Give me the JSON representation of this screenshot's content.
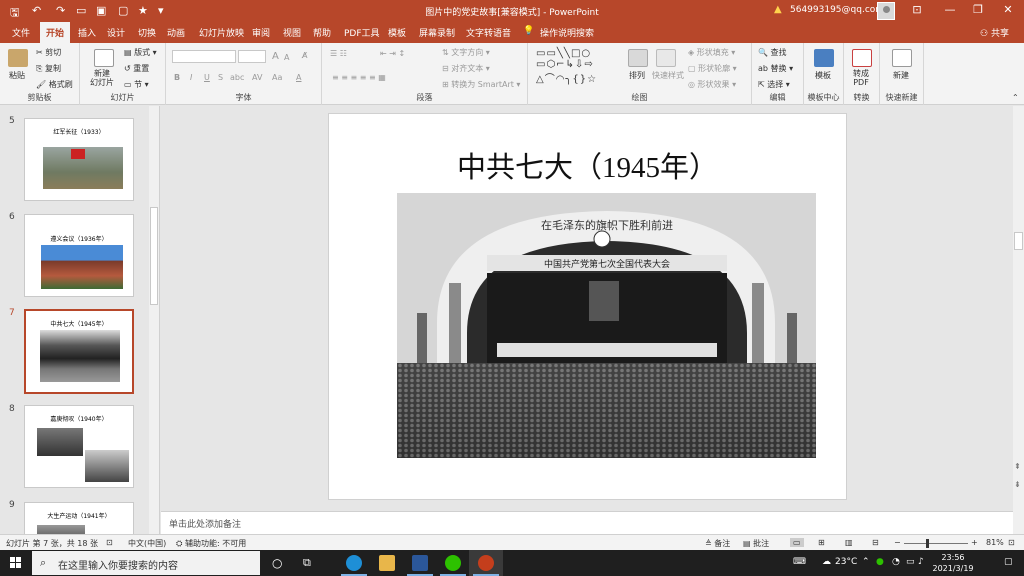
{
  "window": {
    "title": "图片中的党史故事[兼容模式] - PowerPoint",
    "account": "564993195@qq.com",
    "share": "共享"
  },
  "tabs": [
    "文件",
    "开始",
    "插入",
    "设计",
    "切换",
    "动画",
    "幻灯片放映",
    "审阅",
    "视图",
    "帮助",
    "PDF工具",
    "模板",
    "屏幕录制",
    "文字转语音",
    "操作说明搜索"
  ],
  "active_tab": "开始",
  "ribbon": {
    "clipboard": {
      "paste": "粘贴",
      "cut": "剪切",
      "copy": "复制",
      "format_painter": "格式刷",
      "label": "剪贴板"
    },
    "slides": {
      "new_slide": "新建\n幻灯片",
      "layout": "版式",
      "reset": "重置",
      "section": "节",
      "label": "幻灯片"
    },
    "font": {
      "grow": "A",
      "shrink": "A",
      "bold": "B",
      "italic": "I",
      "underline": "U",
      "strike": "S",
      "shadow": "abc",
      "spacing": "AV",
      "case": "Aa",
      "color": "A",
      "label": "字体"
    },
    "paragraph": {
      "direction": "文字方向",
      "align_text": "对齐文本",
      "smartart": "转换为 SmartArt",
      "label": "段落"
    },
    "drawing": {
      "arrange": "排列",
      "quick_styles": "快速样式",
      "fill": "形状填充",
      "outline": "形状轮廓",
      "effects": "形状效果",
      "label": "绘图"
    },
    "editing": {
      "find": "查找",
      "replace": "替换",
      "select": "选择",
      "label": "编辑"
    },
    "template": {
      "btn": "模板",
      "label": "模板中心"
    },
    "convert": {
      "btn": "转成\nPDF",
      "label": "转换"
    },
    "quick_new": {
      "btn": "新建",
      "label": "快速新建"
    }
  },
  "thumbnails": [
    {
      "num": "5",
      "title": "红军长征（1933）"
    },
    {
      "num": "6",
      "title": "遵义会议（1936年）"
    },
    {
      "num": "7",
      "title": "中共七大（1945年）"
    },
    {
      "num": "8",
      "title": "嘉庚彻叹（1940年）"
    },
    {
      "num": "9",
      "title": "大生产运动（1941年）"
    }
  ],
  "slide": {
    "title": "中共七大（1945年）",
    "banner": "中国共产党第七次全国代表大会",
    "arch_text": "在毛泽东的旗帜下胜利前进"
  },
  "notes_placeholder": "单击此处添加备注",
  "status": {
    "slide_info": "幻灯片 第 7 张，共 18 张",
    "language": "中文(中国)",
    "accessibility": "辅助功能: 不可用",
    "notes": "备注",
    "comments": "批注",
    "zoom": "81%"
  },
  "taskbar": {
    "search_placeholder": "在这里输入你要搜索的内容",
    "temperature": "23°C",
    "time": "23:56",
    "date": "2021/3/19",
    "ime": "中"
  },
  "colors": {
    "accent": "#b7472a",
    "ribbon_bg": "#f3f3f3",
    "taskbar": "#1f1f1f"
  }
}
